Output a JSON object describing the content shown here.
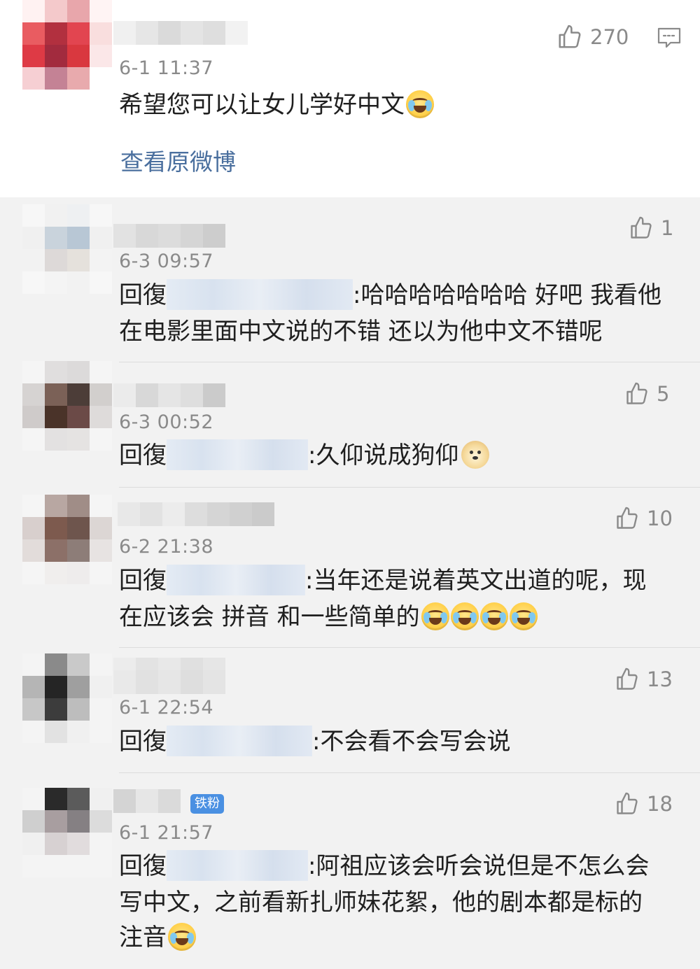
{
  "main_post": {
    "time": "6-1 11:37",
    "likes": "270",
    "text": "希望您可以让女儿学好中文",
    "view_original": "查看原微博",
    "avatar_colors": [
      "#fff2f2",
      "#f4c9cb",
      "#e8a6ab",
      "#fff4f4",
      "#e95c61",
      "#b2303f",
      "#e24550",
      "#f9dede",
      "#de3a45",
      "#a22b3e",
      "#d9383f",
      "#fbe7e8",
      "#f6cfd3",
      "#c48295",
      "#e8aaad",
      "#ffffff"
    ]
  },
  "replies": [
    {
      "time": "6-3 09:57",
      "likes": "1",
      "prefix": "回復",
      "line1": ":哈哈哈哈哈哈哈 好吧 我看他",
      "line2": "在电影里面中文说的不错 还以为他中文不错呢",
      "line3": "",
      "emoji_count": 0,
      "avatar_colors": [
        "#f7f7f7",
        "#f1f1f1",
        "#eef0f2",
        "#f7f7f7",
        "#f0f0f0",
        "#c9d3dc",
        "#b8c7d5",
        "#f0f0f0",
        "#f2f2f2",
        "#ddd9d8",
        "#e5e1dc",
        "#f3f3f3",
        "#f7f7f7",
        "#f4f4f4",
        "#f2f2f2",
        "#f7f7f7"
      ]
    },
    {
      "time": "6-3 00:52",
      "likes": "5",
      "prefix": "回復",
      "line1": ":久仰说成狗仰",
      "line2": "",
      "line3": "",
      "emoji_count": 0,
      "doge": true,
      "avatar_colors": [
        "#f5f5f5",
        "#e0dede",
        "#dcdada",
        "#f5f5f5",
        "#d6d3d2",
        "#7b6157",
        "#4c3d38",
        "#d2cfcd",
        "#cfcbca",
        "#4a3329",
        "#6b4a47",
        "#dedbda",
        "#f5f5f5",
        "#e3e1e1",
        "#e5e3e2",
        "#f5f5f5"
      ]
    },
    {
      "time": "6-2 21:38",
      "likes": "10",
      "prefix": "回復",
      "line1": ":当年还是说着英文出道的呢，现",
      "line2": "在应该会 拼音 和一些简单的",
      "line3": "",
      "emoji_count": 4,
      "avatar_colors": [
        "#f5f5f5",
        "#b8a7a2",
        "#a08d87",
        "#f5f5f5",
        "#d8cfcd",
        "#7d5a4e",
        "#6e554d",
        "#dcd6d4",
        "#e2dcda",
        "#8c7068",
        "#8d7d78",
        "#e7e3e2",
        "#f5f5f5",
        "#f0eeed",
        "#eeecec",
        "#f5f5f5"
      ]
    },
    {
      "time": "6-1 22:54",
      "likes": "13",
      "prefix": "回復",
      "line1": ":不会看不会写会说",
      "line2": "",
      "line3": "",
      "emoji_count": 0,
      "avatar_colors": [
        "#f4f4f4",
        "#8a8a8a",
        "#c9c9c9",
        "#f4f4f4",
        "#b5b5b5",
        "#252525",
        "#9f9f9f",
        "#f0f0f0",
        "#c7c7c7",
        "#3c3c3c",
        "#bdbdbd",
        "#f4f4f4",
        "#f4f4f4",
        "#e2e2e2",
        "#f0f0f0",
        "#f4f4f4"
      ]
    },
    {
      "time": "6-1 21:57",
      "likes": "18",
      "prefix": "回復",
      "badge": "铁粉",
      "line1": ":阿祖应该会听会说但是不怎么会",
      "line2": "写中文，之前看新扎师妹花絮，他的剧本都是标的",
      "line3": "注音",
      "emoji_count": 1,
      "avatar_colors": [
        "#f4f4f4",
        "#2a2a2a",
        "#5b5b5b",
        "#f0f0f0",
        "#cfcfcf",
        "#a89ea0",
        "#858083",
        "#dcdcdc",
        "#f0f0f0",
        "#d7d1d2",
        "#e1dcdd",
        "#f4f4f4",
        "#f4f4f4",
        "#f4f4f4",
        "#f4f4f4",
        "#f4f4f4"
      ]
    }
  ]
}
